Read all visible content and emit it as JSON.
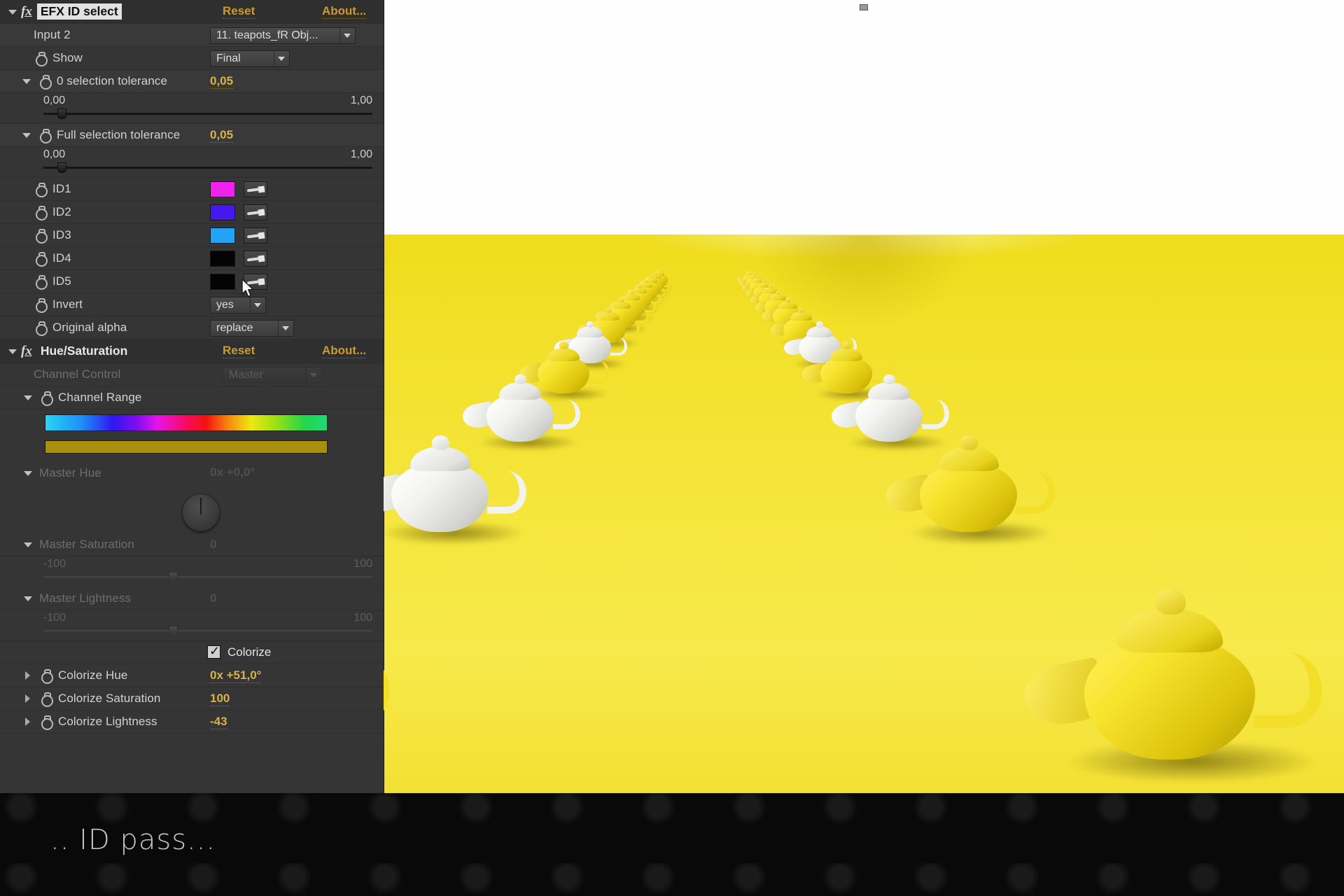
{
  "effects": [
    {
      "id": "efx-id-select",
      "title": "EFX ID select",
      "reset_label": "Reset",
      "about_label": "About...",
      "selected": true,
      "params": [
        {
          "kind": "dropdown",
          "label": "Input 2",
          "value": "11. teapots_fR Obj...",
          "indent": 1,
          "stopwatch": false,
          "enabled": true
        },
        {
          "kind": "dropdown",
          "label": "Show",
          "value": "Final",
          "indent": 2,
          "stopwatch": true,
          "enabled": true
        },
        {
          "kind": "slider",
          "label": "0 selection tolerance",
          "value": "0,05",
          "min": "0,00",
          "max": "1,00",
          "fraction": 0.05,
          "indent": 1,
          "expanded": true
        },
        {
          "kind": "slider",
          "label": "Full selection tolerance",
          "value": "0,05",
          "min": "0,00",
          "max": "1,00",
          "fraction": 0.05,
          "indent": 1,
          "expanded": true
        },
        {
          "kind": "color",
          "label": "ID1",
          "color": "#ef23ec",
          "indent": 2
        },
        {
          "kind": "color",
          "label": "ID2",
          "color": "#4618f0",
          "indent": 2
        },
        {
          "kind": "color",
          "label": "ID3",
          "color": "#23a3f5",
          "indent": 2
        },
        {
          "kind": "color",
          "label": "ID4",
          "color": "#040404",
          "indent": 2
        },
        {
          "kind": "color",
          "label": "ID5",
          "color": "#040404",
          "indent": 2
        },
        {
          "kind": "dropdown",
          "label": "Invert",
          "value": "yes",
          "indent": 2,
          "stopwatch": true,
          "enabled": true
        },
        {
          "kind": "dropdown",
          "label": "Original alpha",
          "value": "replace",
          "indent": 2,
          "stopwatch": true,
          "enabled": true
        }
      ]
    },
    {
      "id": "hue-saturation",
      "title": "Hue/Saturation",
      "reset_label": "Reset",
      "about_label": "About...",
      "selected": false,
      "params": [
        {
          "kind": "dropdown",
          "label": "Channel Control",
          "value": "Master",
          "indent": 1,
          "stopwatch": false,
          "enabled": false
        },
        {
          "kind": "group",
          "label": "Channel Range",
          "indent": 1,
          "stopwatch": true,
          "expanded": true
        },
        {
          "kind": "dial",
          "label": "Master Hue",
          "value": "0x +0,0°",
          "indent": 1,
          "enabled": false
        },
        {
          "kind": "slider",
          "label": "Master Saturation",
          "value": "0",
          "min": "-100",
          "max": "100",
          "fraction": 0.5,
          "indent": 1,
          "expanded": true,
          "enabled": false
        },
        {
          "kind": "slider",
          "label": "Master Lightness",
          "value": "0",
          "min": "-100",
          "max": "100",
          "fraction": 0.5,
          "indent": 1,
          "expanded": true,
          "enabled": false
        },
        {
          "kind": "checkbox",
          "label": "Colorize",
          "checked": true
        },
        {
          "kind": "value",
          "label": "Colorize Hue",
          "value": "0x +51,0°",
          "indent": 1,
          "expanded": false
        },
        {
          "kind": "value",
          "label": "Colorize Saturation",
          "value": "100",
          "indent": 1,
          "expanded": false
        },
        {
          "kind": "value",
          "label": "Colorize Lightness",
          "value": "-43",
          "indent": 1,
          "expanded": false
        }
      ]
    }
  ],
  "labels": {
    "input2": "Input 2",
    "show": "Show",
    "zero_sel_tol": "0 selection tolerance",
    "full_sel_tol": "Full selection tolerance",
    "id1": "ID1",
    "id2": "ID2",
    "id3": "ID3",
    "id4": "ID4",
    "id5": "ID5",
    "invert": "Invert",
    "original_alpha": "Original alpha",
    "channel_control": "Channel Control",
    "channel_range": "Channel Range",
    "master_hue": "Master Hue",
    "master_saturation": "Master Saturation",
    "master_lightness": "Master Lightness",
    "colorize": "Colorize",
    "colorize_hue": "Colorize Hue",
    "colorize_saturation": "Colorize Saturation",
    "colorize_lightness": "Colorize Lightness"
  },
  "values": {
    "input2": "11. teapots_fR Obj...",
    "show": "Final",
    "zero_sel_tol": "0,05",
    "full_sel_tol": "0,05",
    "invert": "yes",
    "original_alpha": "replace",
    "channel_control": "Master",
    "master_hue": "0x +0,0°",
    "master_saturation": "0",
    "master_lightness": "0",
    "colorize_hue": "0x +51,0°",
    "colorize_saturation": "100",
    "colorize_lightness": "-43"
  },
  "ranges": {
    "tol_min": "0,00",
    "tol_max": "1,00",
    "sat_min": "-100",
    "sat_max": "100",
    "light_min": "-100",
    "light_max": "100"
  },
  "headers": {
    "efx_title": "EFX ID select",
    "efx_reset": "Reset",
    "efx_about": "About...",
    "hs_title": "Hue/Saturation",
    "hs_reset": "Reset",
    "hs_about": "About..."
  },
  "colors": {
    "id1": "#ef23ec",
    "id2": "#4618f0",
    "id3": "#23a3f5",
    "id4": "#040404",
    "id5": "#040404",
    "range_bar": "#a8900f",
    "accent_value": "#d6b34b",
    "panel_bg": "#353535",
    "floor_yellow": "#f2e02a"
  },
  "caption": {
    "text": ".. ID pass..."
  },
  "viewer": {
    "alt_text": "3D render of rows of white and yellow teapots receding toward a vanishing point on a yellow floor with a white background"
  }
}
